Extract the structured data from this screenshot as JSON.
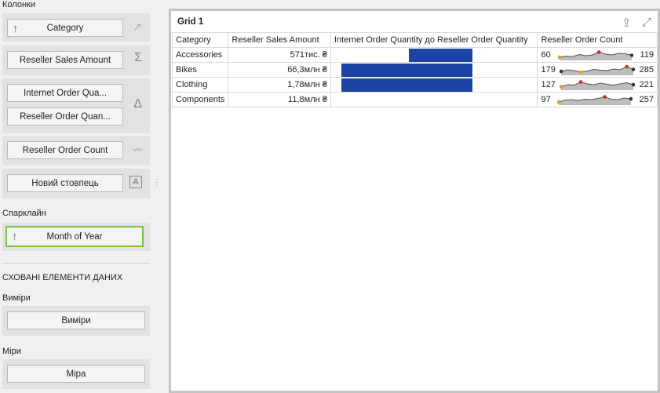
{
  "sidebar": {
    "columns_title": "Колонки",
    "category": "Category",
    "reseller_sales_amount": "Reseller Sales Amount",
    "internet_order_qty": "Internet Order Qua...",
    "reseller_order_qty": "Reseller Order Quan...",
    "reseller_order_count": "Reseller Order Count",
    "new_column": "Новий стовпець",
    "sparkline_title": "Спарклайн",
    "month_of_year": "Month of Year",
    "hidden_title": "СХОВАНІ ЕЛЕМЕНТИ ДАНИХ",
    "dimensions_title": "Виміри",
    "dimensions_btn": "Виміри",
    "measures_title": "Міри",
    "measures_btn": "Міра"
  },
  "grid": {
    "title": "Grid 1",
    "headers": [
      "Category",
      "Reseller Sales Amount",
      "Internet Order Quantity до Reseller Order Quantity",
      "Reseller Order Count"
    ],
    "rows": [
      {
        "category": "Accessories",
        "amount": "571тис. ₴",
        "ratio": 0.45,
        "bar_side": "right",
        "start": "60",
        "end": "119"
      },
      {
        "category": "Bikes",
        "amount": "66,3млн ₴",
        "ratio": 1.0,
        "bar_side": "left",
        "start": "179",
        "end": "285"
      },
      {
        "category": "Clothing",
        "amount": "1,78млн ₴",
        "ratio": 1.0,
        "bar_side": "left",
        "start": "127",
        "end": "221"
      },
      {
        "category": "Components",
        "amount": "11,8млн ₴",
        "ratio": 0.0,
        "bar_side": "left",
        "start": "97",
        "end": "257"
      }
    ]
  },
  "colors": {
    "bar": "#1c44a4",
    "highlight": "#7ac143",
    "spark_min": "#f39c12",
    "spark_max": "#d62728"
  }
}
